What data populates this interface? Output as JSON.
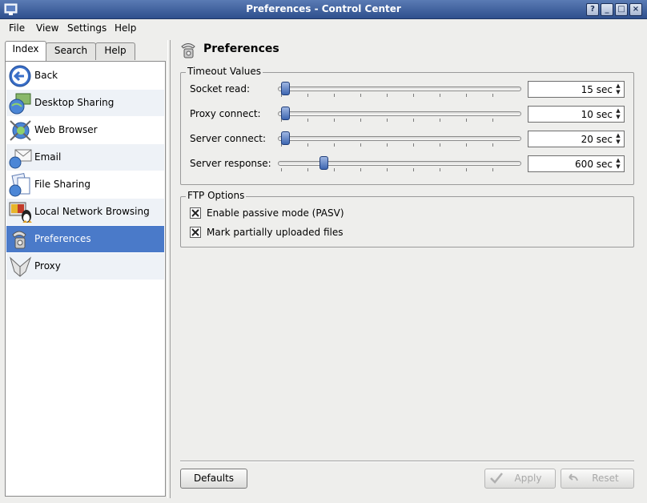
{
  "window": {
    "title": "Preferences - Control Center",
    "buttons": [
      "?",
      "_",
      "□",
      "×"
    ]
  },
  "menubar": [
    {
      "label": "File"
    },
    {
      "label": "View"
    },
    {
      "label": "Settings"
    },
    {
      "label": "Help"
    }
  ],
  "tabs": [
    {
      "label": "Index"
    },
    {
      "label": "Search"
    },
    {
      "label": "Help"
    }
  ],
  "sidebar": {
    "items": [
      {
        "label": "Back",
        "icon": "back-arrow-icon"
      },
      {
        "label": "Desktop Sharing",
        "icon": "desktop-sharing-icon"
      },
      {
        "label": "Web Browser",
        "icon": "web-browser-icon"
      },
      {
        "label": "Email",
        "icon": "email-icon"
      },
      {
        "label": "File Sharing",
        "icon": "file-sharing-icon"
      },
      {
        "label": "Local Network Browsing",
        "icon": "network-browsing-icon"
      },
      {
        "label": "Preferences",
        "icon": "preferences-icon",
        "selected": true
      },
      {
        "label": "Proxy",
        "icon": "proxy-icon"
      }
    ]
  },
  "page": {
    "title": "Preferences"
  },
  "timeouts": {
    "title": "Timeout Values",
    "rows": [
      {
        "label": "Socket read:",
        "value": "15 sec",
        "level": 0
      },
      {
        "label": "Proxy connect:",
        "value": "10 sec",
        "level": 0
      },
      {
        "label": "Server connect:",
        "value": "20 sec",
        "level": 0
      },
      {
        "label": "Server response:",
        "value": "600 sec",
        "level": 0.17
      }
    ]
  },
  "ftp": {
    "title": "FTP Options",
    "options": [
      {
        "label": "Enable passive mode (PASV)",
        "checked": true
      },
      {
        "label": "Mark partially uploaded files",
        "checked": true
      }
    ]
  },
  "buttons": {
    "defaults": "Defaults",
    "apply": "Apply",
    "reset": "Reset"
  },
  "colors": {
    "selection": "#4a7ac9",
    "titlebar": "#3d5f9e",
    "background": "#eeeeec"
  }
}
